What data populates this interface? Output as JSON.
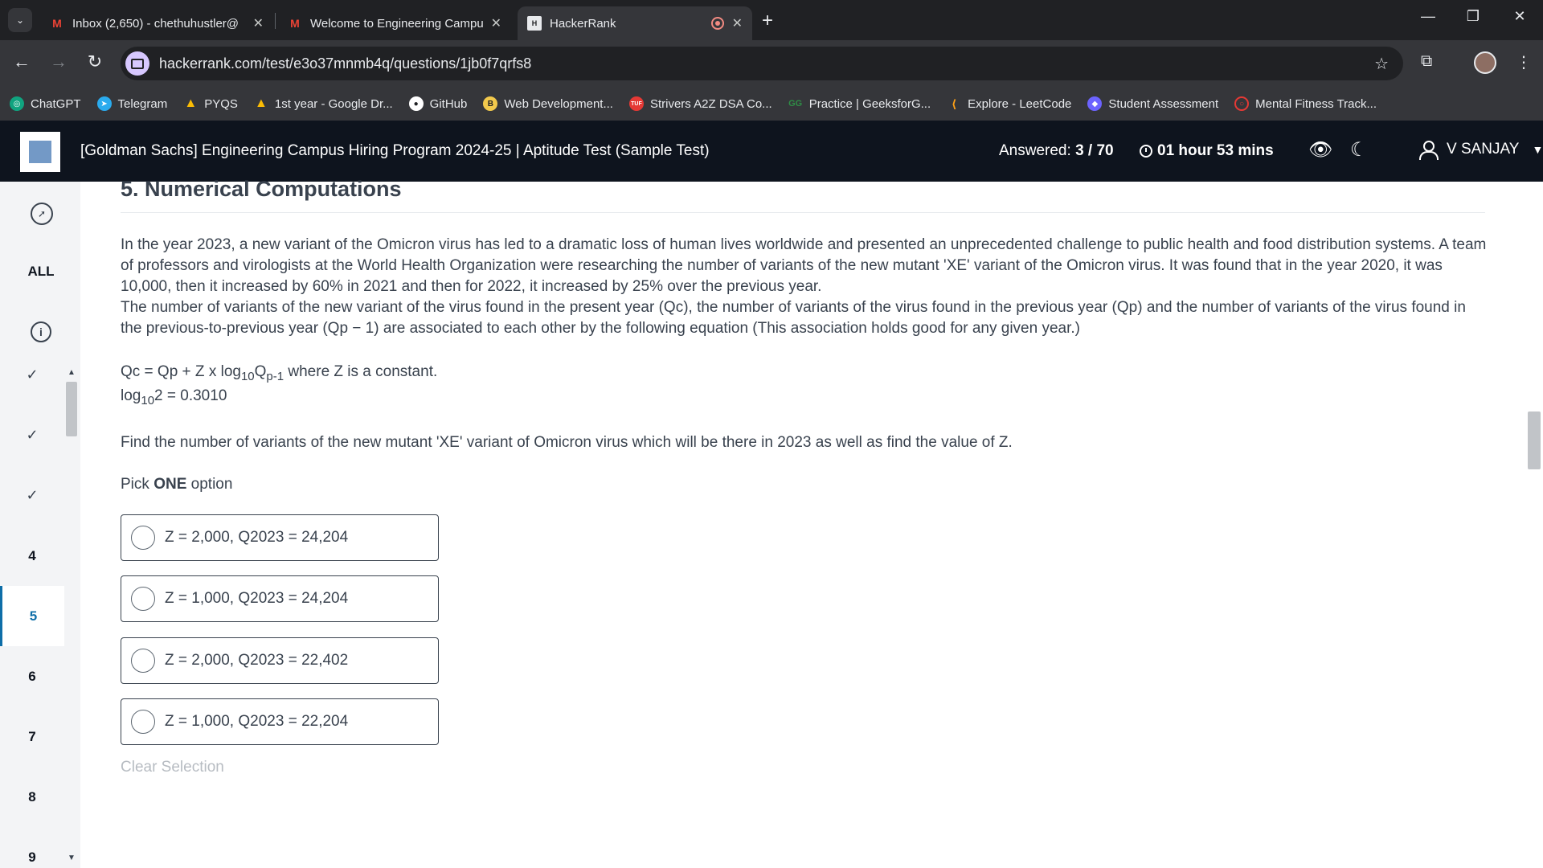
{
  "browser": {
    "tabs": [
      {
        "title": "Inbox (2,650) - chethuhustler@",
        "icon": "gmail-icon"
      },
      {
        "title": "Welcome to Engineering Campu",
        "icon": "gmail-icon"
      },
      {
        "title": "HackerRank",
        "icon": "hackerrank-icon",
        "active": true
      }
    ],
    "url": "hackerrank.com/test/e3o37mnmb4q/questions/1jb0f7qrfs8",
    "bookmarks": [
      {
        "label": "ChatGPT",
        "icon": "chatgpt-icon",
        "color": "#10a37f"
      },
      {
        "label": "Telegram",
        "icon": "telegram-icon",
        "color": "#2aabee"
      },
      {
        "label": "PYQS",
        "icon": "drive-icon",
        "color": "#fbbc04"
      },
      {
        "label": "1st year - Google Dr...",
        "icon": "drive-icon",
        "color": "#fbbc04"
      },
      {
        "label": "GitHub",
        "icon": "github-icon",
        "color": "#ffffff"
      },
      {
        "label": "Web Development...",
        "icon": "bookmark-icon",
        "color": "#f2c94c"
      },
      {
        "label": "Strivers A2Z DSA Co...",
        "icon": "tuf-icon",
        "color": "#e53935"
      },
      {
        "label": "Practice | GeeksforG...",
        "icon": "gfg-icon",
        "color": "#2f8d46"
      },
      {
        "label": "Explore - LeetCode",
        "icon": "leetcode-icon",
        "color": "#ffa116"
      },
      {
        "label": "Student Assessment",
        "icon": "assessment-icon",
        "color": "#6c63ff"
      },
      {
        "label": "Mental Fitness Track...",
        "icon": "fitness-icon",
        "color": "#e53935"
      }
    ]
  },
  "header": {
    "title": "[Goldman Sachs] Engineering Campus Hiring Program 2024-25 | Aptitude Test (Sample Test)",
    "answered_label": "Answered:",
    "answered_value": "3 / 70",
    "timer": "01 hour 53 mins",
    "user": "V SANJAY"
  },
  "rail": {
    "all_label": "ALL",
    "items": [
      {
        "label": "✓",
        "state": "answered"
      },
      {
        "label": "✓",
        "state": "answered"
      },
      {
        "label": "✓",
        "state": "answered"
      },
      {
        "label": "4",
        "state": "unanswered"
      },
      {
        "label": "5",
        "state": "current"
      },
      {
        "label": "6",
        "state": "unanswered"
      },
      {
        "label": "7",
        "state": "unanswered"
      },
      {
        "label": "8",
        "state": "unanswered"
      },
      {
        "label": "9",
        "state": "unanswered"
      }
    ]
  },
  "question": {
    "heading": "5. Numerical Computations",
    "para1": "In the year 2023, a new variant of the Omicron virus has led to a dramatic loss of human lives worldwide and presented an unprecedented challenge to public health and food distribution systems. A team of professors and virologists at the World Health Organization were researching the number of variants of the new mutant 'XE' variant of the Omicron virus. It was found that in the year 2020, it was 10,000, then it increased by 60% in 2021 and then for 2022, it increased by 25% over the previous year.",
    "para2": "The number of variants of the new variant of the virus found in the present year (Qc), the number of variants of the virus found in the previous year (Qp) and the number of variants of the virus found in the previous-to-previous year (Qp − 1) are associated to each other by the following equation (This association holds good for any given year.)",
    "eq1_a": "Qc = Qp + Z x log",
    "eq1_sub1": "10",
    "eq1_b": "Q",
    "eq1_sub2": "p-1",
    "eq1_c": " where Z is a constant.",
    "eq2_a": "log",
    "eq2_sub": "10",
    "eq2_b": "2 = 0.3010",
    "prompt": "Find the number of variants of the new mutant 'XE' variant of Omicron virus which will be there in 2023 as well as find the value of Z.",
    "pick_prefix": "Pick ",
    "pick_bold": "ONE",
    "pick_suffix": " option",
    "options": [
      "Z = 2,000, Q2023 = 24,204",
      "Z = 1,000, Q2023 = 24,204",
      "Z = 2,000, Q2023 = 22,402",
      "Z = 1,000, Q2023 = 22,204"
    ],
    "clear_label": "Clear Selection"
  }
}
